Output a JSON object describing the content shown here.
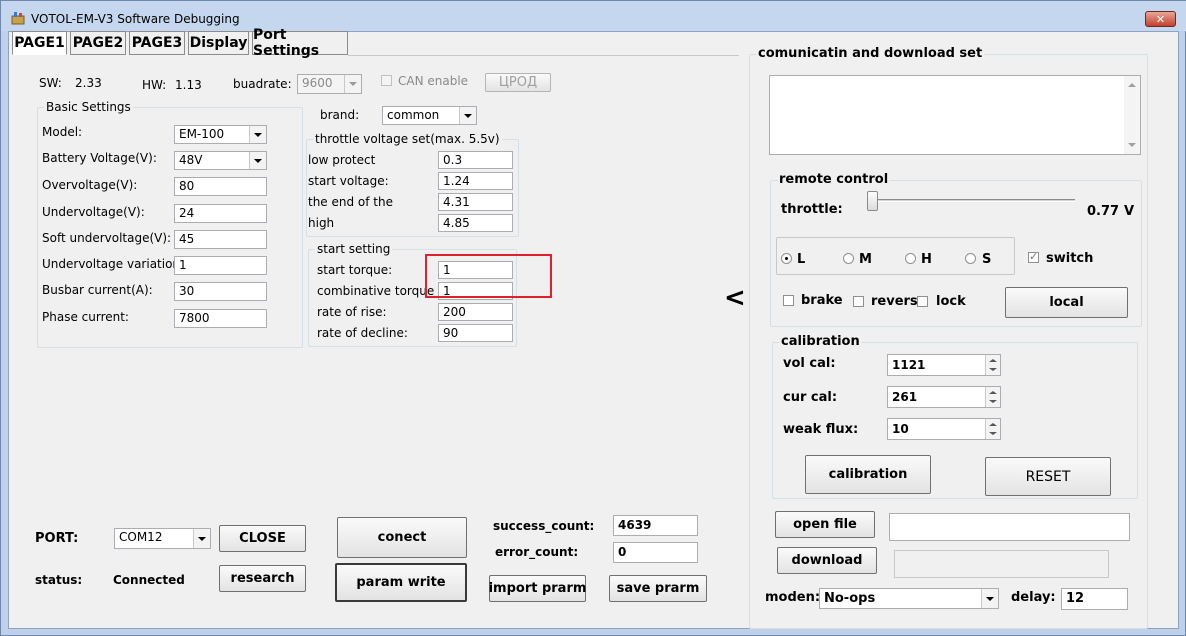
{
  "window": {
    "title": "VOTOL-EM-V3 Software Debugging",
    "close_glyph": "✕"
  },
  "tabs": [
    "PAGE1",
    "PAGE2",
    "PAGE3",
    "Display",
    "Port Settings"
  ],
  "header": {
    "sw_label": "SW:",
    "sw_value": "2.33",
    "hw_label": "HW:",
    "hw_value": "1.13",
    "baud_label": "buadrate:",
    "baud_value": "9600",
    "can_label": "CAN enable",
    "can_checked": false,
    "upgrade_label": "ЦРОД"
  },
  "basic": {
    "title": "Basic Settings",
    "model_label": "Model:",
    "model_value": "EM-100",
    "battery_label": "Battery Voltage(V):",
    "battery_value": "48V",
    "overvoltage_label": "Overvoltage(V):",
    "overvoltage_value": "80",
    "undervoltage_label": "Undervoltage(V):",
    "undervoltage_value": "24",
    "soft_label": "Soft undervoltage(V):",
    "soft_value": "45",
    "variation_label": "Undervoltage variation:",
    "variation_value": "1",
    "busbar_label": "Busbar current(A):",
    "busbar_value": "30",
    "phase_label": "Phase current:",
    "phase_value": "7800"
  },
  "brand": {
    "label": "brand:",
    "value": "common"
  },
  "throttle_set": {
    "title": "throttle voltage set(max. 5.5v)",
    "low_label": "low protect",
    "low_value": "0.3",
    "start_label": "start voltage:",
    "start_value": "1.24",
    "end_label": "the end of the",
    "end_value": "4.31",
    "high_label": "high",
    "high_value": "4.85"
  },
  "start_setting": {
    "title": "start setting",
    "torque_label": "start torque:",
    "torque_value": "1",
    "comb_label": "combinative torque",
    "comb_value": "1",
    "rise_label": "rate of rise:",
    "rise_value": "200",
    "decline_label": "rate of decline:",
    "decline_value": "90",
    "highlight_color": "#e0202a"
  },
  "port": {
    "port_label": "PORT:",
    "port_value": "COM12",
    "close_label": "CLOSE",
    "status_label": "status:",
    "status_value": "Connected",
    "research_label": "research",
    "connect_label": "conect",
    "param_write_label": "param write",
    "success_label": "success_count:",
    "success_value": "4639",
    "error_label": "error_count:",
    "error_value": "0",
    "import_label": "import prarm",
    "save_label": "save prarm"
  },
  "collapse_glyph": "<",
  "comm": {
    "title": "comunicatin and download set",
    "log_text": ""
  },
  "remote": {
    "title": "remote control",
    "throttle_label": "throttle:",
    "throttle_value": "0.77",
    "throttle_unit": "V",
    "throttle_fraction": 0.0,
    "gears": [
      "L",
      "M",
      "H",
      "S"
    ],
    "gear_selected": "L",
    "switch_label": "switch",
    "switch_checked": true,
    "brake_label": "brake",
    "reverse_label": "reverse",
    "lock_label": "lock",
    "local_label": "local"
  },
  "calibration": {
    "title": "calibration",
    "vol_label": "vol cal:",
    "vol_value": "1121",
    "cur_label": "cur cal:",
    "cur_value": "261",
    "weak_label": "weak flux:",
    "weak_value": "10",
    "calibrate_label": "calibration",
    "reset_label": "RESET"
  },
  "download": {
    "open_label": "open file",
    "file_path": "",
    "download_label": "download",
    "progress": 0.0,
    "moden_label": "moden:",
    "moden_value": "No-ops",
    "delay_label": "delay:",
    "delay_value": "12"
  }
}
